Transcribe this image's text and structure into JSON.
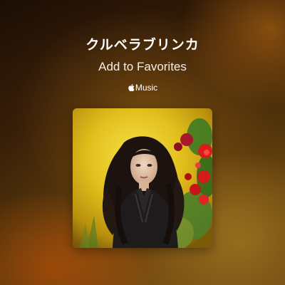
{
  "share_card": {
    "title": "クルベラブリンカ",
    "action": "Add to Favorites",
    "brand_label": "Music",
    "brand_icon": "apple-logo-icon"
  },
  "artwork": {
    "subject": "album-cover"
  },
  "colors": {
    "background_dark": "#241206",
    "background_orange": "#c85a0a",
    "background_gold": "#b98c28",
    "text": "#ffffff",
    "artwork_yellow": "#e6c21a",
    "flower_red": "#d81c1c"
  }
}
